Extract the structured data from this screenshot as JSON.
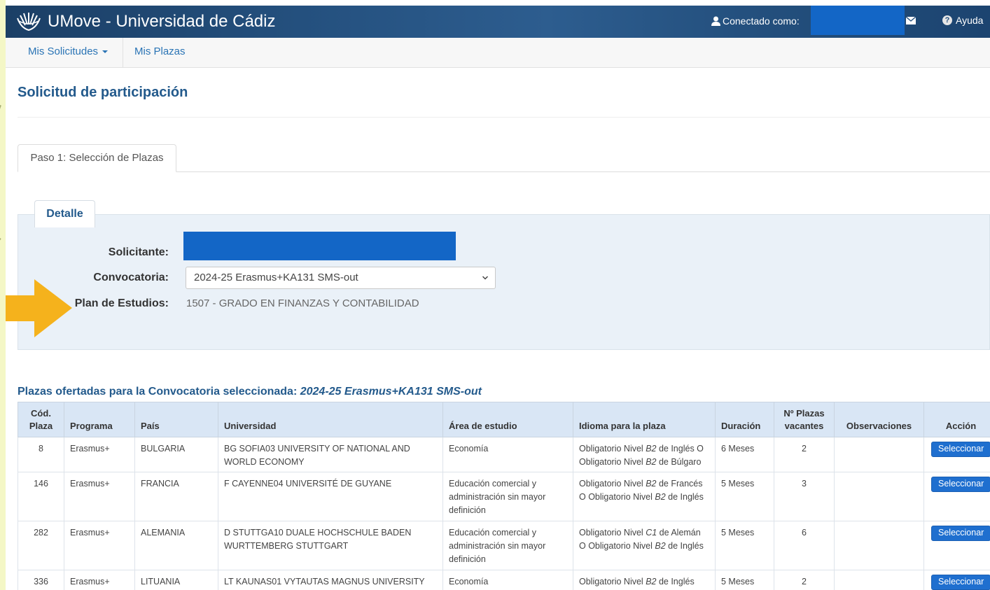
{
  "header": {
    "app_title": "UMove - Universidad de Cádiz",
    "connected_label": "Conectado como:",
    "help_label": "Ayuda"
  },
  "nav": {
    "items": [
      {
        "label": "Mis Solicitudes"
      },
      {
        "label": "Mis Plazas"
      }
    ]
  },
  "page": {
    "title": "Solicitud de participación",
    "tab_label": "Paso 1: Selección de Plazas"
  },
  "detail": {
    "legend": "Detalle",
    "solicitante_label": "Solicitante:",
    "convocatoria_label": "Convocatoria:",
    "convocatoria_value": "2024-25 Erasmus+KA131 SMS-out",
    "plan_label": "Plan de Estudios:",
    "plan_value": "1507 - GRADO EN FINANZAS Y CONTABILIDAD"
  },
  "table": {
    "title_prefix": "Plazas ofertadas para la Convocatoria seleccionada:",
    "title_value": "2024-25 Erasmus+KA131 SMS-out",
    "headers": {
      "cod_line1": "Cód.",
      "cod_line2": "Plaza",
      "programa": "Programa",
      "pais": "País",
      "universidad": "Universidad",
      "area": "Área de estudio",
      "idioma": "Idioma para la plaza",
      "duracion": "Duración",
      "vacantes_line1": "Nº Plazas",
      "vacantes_line2": "vacantes",
      "observaciones": "Observaciones",
      "accion": "Acción"
    },
    "action_label": "Seleccionar",
    "rows": [
      {
        "cod": "8",
        "programa": "Erasmus+",
        "pais": "BULGARIA",
        "universidad": "BG SOFIA03 UNIVERSITY OF NATIONAL AND WORLD ECONOMY",
        "area": "Economía",
        "idioma1_pre": "Obligatorio Nivel ",
        "idioma1_lvl": "B2",
        "idioma1_post": " de Inglés O",
        "idioma2_pre": "Obligatorio Nivel ",
        "idioma2_lvl": "B2",
        "idioma2_post": " de Búlgaro",
        "duracion": "6 Meses",
        "vacantes": "2",
        "observaciones": ""
      },
      {
        "cod": "146",
        "programa": "Erasmus+",
        "pais": "FRANCIA",
        "universidad": "F CAYENNE04 UNIVERSITÉ DE GUYANE",
        "area": "Educación comercial y administración sin mayor definición",
        "idioma1_pre": "Obligatorio Nivel ",
        "idioma1_lvl": "B2",
        "idioma1_post": " de Francés",
        "idioma2_pre": "O Obligatorio Nivel ",
        "idioma2_lvl": "B2",
        "idioma2_post": " de Inglés",
        "duracion": "5 Meses",
        "vacantes": "3",
        "observaciones": ""
      },
      {
        "cod": "282",
        "programa": "Erasmus+",
        "pais": "ALEMANIA",
        "universidad": "D STUTTGA10 DUALE HOCHSCHULE BADEN WURTTEMBERG STUTTGART",
        "area": "Educación comercial y administración sin mayor definición",
        "idioma1_pre": "Obligatorio Nivel ",
        "idioma1_lvl": "C1",
        "idioma1_post": " de Alemán",
        "idioma2_pre": "O Obligatorio Nivel ",
        "idioma2_lvl": "B2",
        "idioma2_post": " de Inglés",
        "duracion": "5 Meses",
        "vacantes": "6",
        "observaciones": ""
      },
      {
        "cod": "336",
        "programa": "Erasmus+",
        "pais": "LITUANIA",
        "universidad": "LT KAUNAS01 VYTAUTAS MAGNUS UNIVERSITY",
        "area": "Economía",
        "idioma1_pre": "Obligatorio Nivel ",
        "idioma1_lvl": "B2",
        "idioma1_post": " de Inglés",
        "idioma2_pre": "",
        "idioma2_lvl": "",
        "idioma2_post": "",
        "duracion": "5 Meses",
        "vacantes": "2",
        "observaciones": ""
      }
    ]
  },
  "colors": {
    "accent": "#235a8c",
    "header_bg": "#24507e",
    "button": "#1f6fcf",
    "annotation_arrow": "#f5b21c",
    "redaction": "#1366c6"
  }
}
